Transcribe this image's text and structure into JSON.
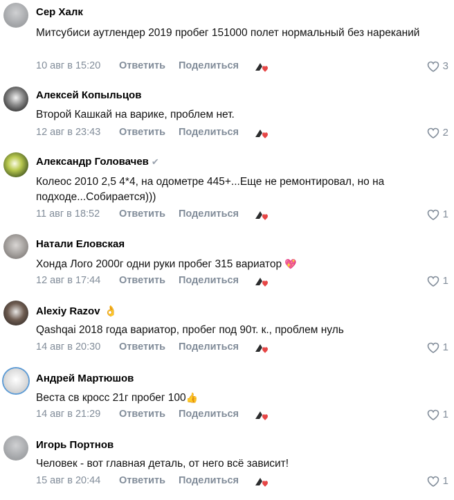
{
  "comments": [
    {
      "author": "Сер Халк",
      "author_extra": "",
      "verified": false,
      "text": "Митсубиси аутлендер 2019 пробег 151000 полет нормальный без нареканий",
      "emoji": "",
      "date": "10 авг в 15:20",
      "likes": "3"
    },
    {
      "author": "Алексей Копыльцов",
      "author_extra": "",
      "verified": false,
      "text": "Второй Кашкай на варике, проблем нет.",
      "emoji": "",
      "date": "12 авг в 23:43",
      "likes": "2"
    },
    {
      "author": "Александр Головачев",
      "author_extra": "",
      "verified": true,
      "text": "Колеос 2010 2,5 4*4, на одометре 445+...Еще не ремонтировал, но на подходе...Собирается)))",
      "emoji": "",
      "date": "11 авг в 18:52",
      "likes": "1"
    },
    {
      "author": "Натали Еловская",
      "author_extra": "",
      "verified": false,
      "text": "Хонда Лого 2000г одни руки пробег 315 вариатор",
      "emoji": "💖",
      "date": "12 авг в 17:44",
      "likes": "1"
    },
    {
      "author": "Alexiy Razov",
      "author_extra": "👌",
      "verified": false,
      "text": "Qashqai 2018 года вариатор, пробег под 90т. к., проблем нуль",
      "emoji": "",
      "date": "14 авг в 20:30",
      "likes": "1"
    },
    {
      "author": "Андрей Мартюшов",
      "author_extra": "",
      "verified": false,
      "text": "Веста св кросс 21г пробег 100",
      "emoji": "👍",
      "date": "14 авг в 21:29",
      "likes": "1"
    },
    {
      "author": "Игорь Портнов",
      "author_extra": "",
      "verified": false,
      "text": "Человек - вот главная деталь, от него всё зависит!",
      "emoji": "",
      "date": "15 авг в 20:44",
      "likes": "1"
    }
  ],
  "labels": {
    "reply": "Ответить",
    "share": "Поделиться"
  },
  "colors": {
    "meta": "#818c99",
    "text": "#000000",
    "reaction_red": "#e64646",
    "reaction_dark": "#2c2d2e"
  }
}
